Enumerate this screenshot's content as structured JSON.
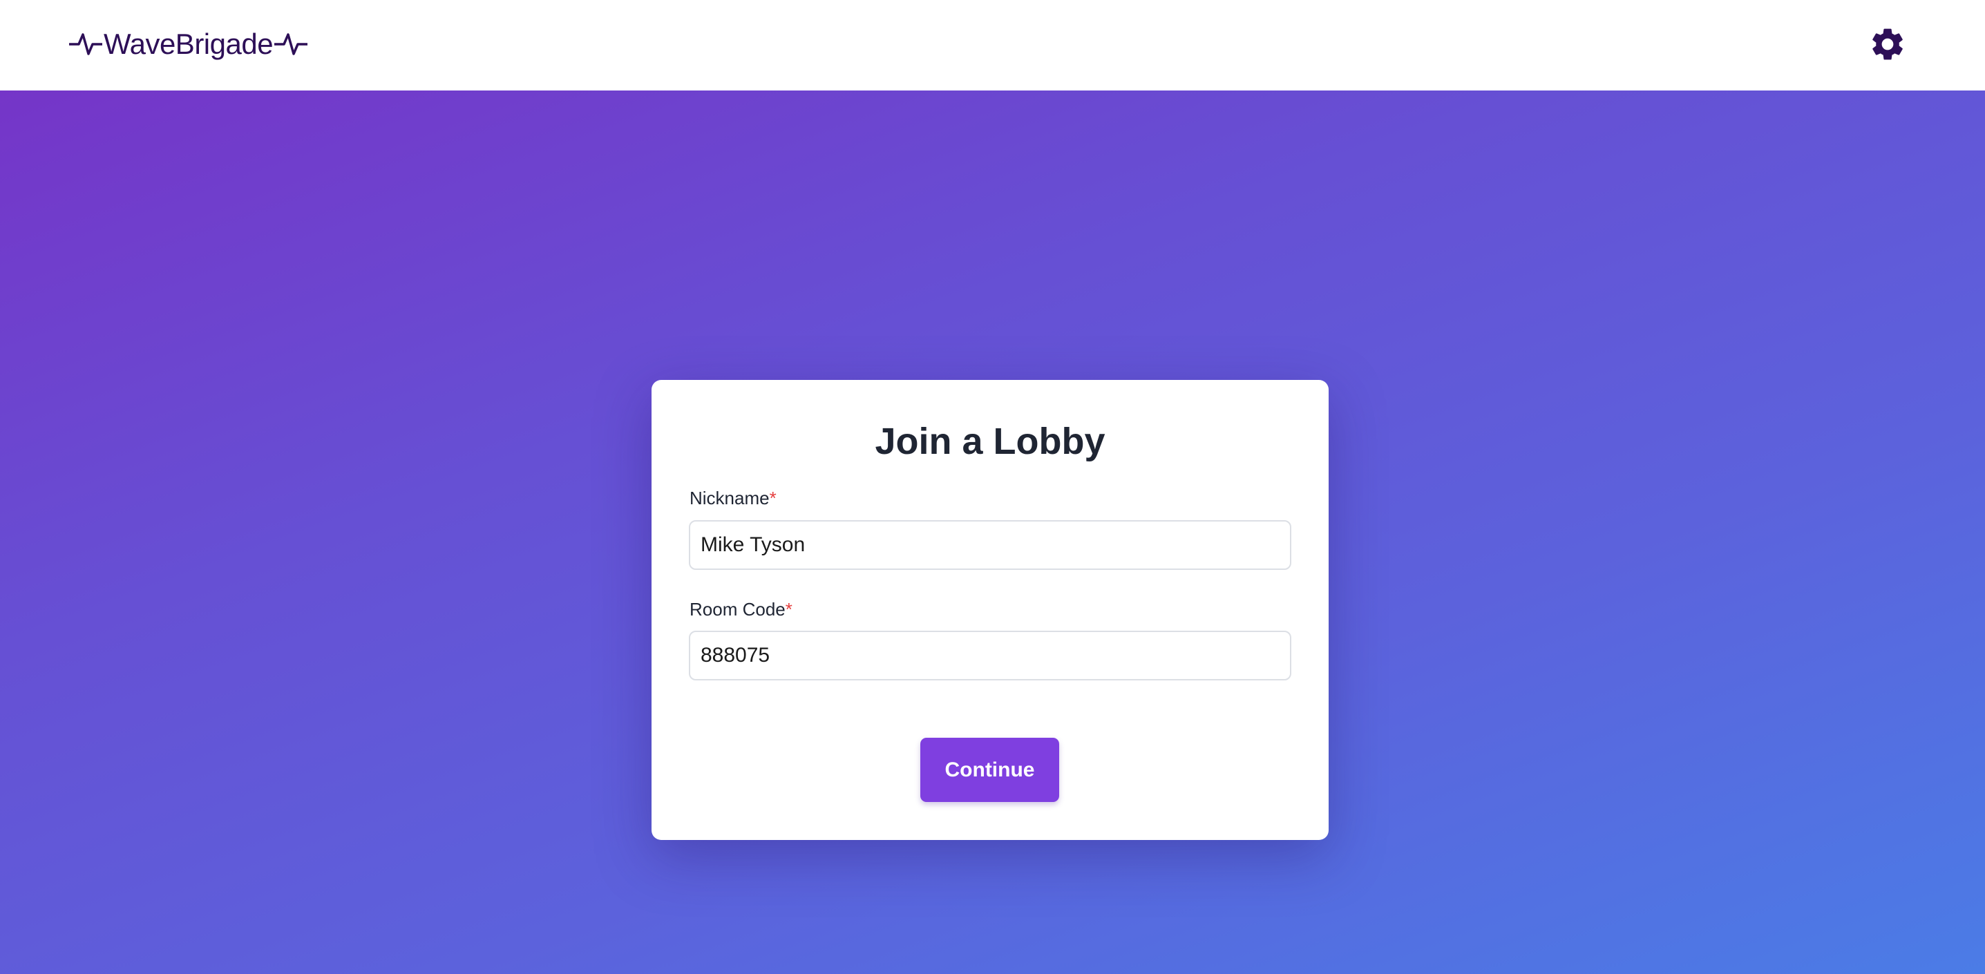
{
  "app": {
    "name": "WaveBrigade",
    "brand_color": "#2d0f57",
    "settings_icon": "gear-icon"
  },
  "form": {
    "title": "Join a Lobby",
    "nickname": {
      "label": "Nickname",
      "required_mark": "*",
      "value": "Mike Tyson"
    },
    "room_code": {
      "label": "Room Code",
      "required_mark": "*",
      "value": "888075"
    },
    "submit_label": "Continue",
    "accent_color": "#7f3fe0"
  }
}
